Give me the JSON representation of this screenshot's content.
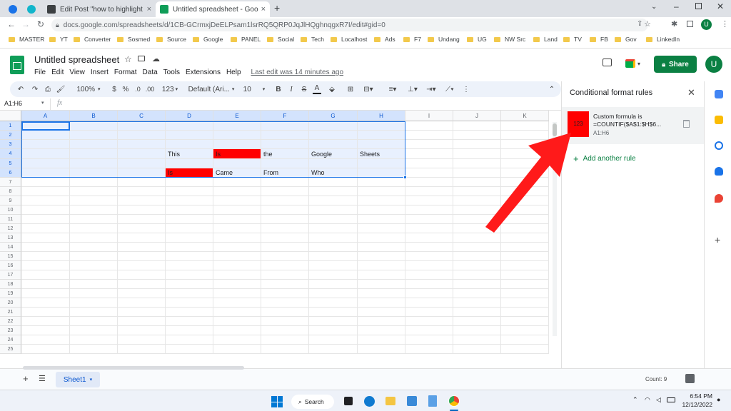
{
  "browser": {
    "tabs": [
      {
        "title": "",
        "color": "#1a73e8"
      },
      {
        "title": "",
        "color": "#12b5cb"
      },
      {
        "title": "Edit Post \"how to highlight dupli...",
        "color": "#3c4043"
      },
      {
        "title": "Untitled spreadsheet - Google Sh...",
        "color": "#0f9d58"
      }
    ],
    "new_tab": "+",
    "url": "docs.google.com/spreadsheets/d/1CB-GCrmxjDeELPsam1lsrRQ5QRP0JqJlHQghnqgxR7I/edit#gid=0",
    "profile": "U",
    "bookmarks": [
      "MASTER",
      "YT",
      "Converter",
      "Sosmed",
      "Source",
      "Google",
      "PANEL",
      "Social",
      "Tech",
      "Localhost",
      "Ads",
      "F7",
      "Undang",
      "UG",
      "NW Src",
      "Land",
      "TV",
      "FB",
      "Gov",
      "LinkedIn"
    ]
  },
  "sheets": {
    "title": "Untitled spreadsheet",
    "menus": [
      "File",
      "Edit",
      "View",
      "Insert",
      "Format",
      "Data",
      "Tools",
      "Extensions",
      "Help"
    ],
    "last_edit": "Last edit was 14 minutes ago",
    "share_label": "Share",
    "avatar": "U",
    "toolbar": {
      "zoom": "100%",
      "currency": "$",
      "percent": "%",
      "dec_less": ".0",
      "dec_more": ".00",
      "number_format": "123",
      "font": "Default (Ari...",
      "font_size": "10",
      "bold": "B",
      "italic": "I",
      "strike": "S",
      "text_color": "A"
    },
    "name_box": "A1:H6",
    "fx": "fx",
    "columns": [
      "A",
      "B",
      "C",
      "D",
      "E",
      "F",
      "G",
      "H",
      "I",
      "J",
      "K"
    ],
    "rows": [
      "1",
      "2",
      "3",
      "4",
      "5",
      "6",
      "7",
      "8",
      "9",
      "10",
      "11",
      "12",
      "13",
      "14",
      "15",
      "16",
      "17",
      "18",
      "19",
      "20",
      "21",
      "22",
      "23",
      "24",
      "25"
    ],
    "cells": {
      "D4": "This",
      "E4": "Is",
      "F4": "the",
      "G4": "Google",
      "H4": "Sheets",
      "D6": "Is",
      "E6": "Came",
      "F6": "From",
      "G6": "Who"
    },
    "highlight_color": "#ff0000",
    "selection_color": "#e8f0fe",
    "sheet_tab": "Sheet1",
    "count": "Count: 9"
  },
  "panel": {
    "title": "Conditional format rules",
    "rule": {
      "preview": "123",
      "line1": "Custom formula is",
      "line2": "=COUNTIF($A$1:$H$6...",
      "range": "A1:H6"
    },
    "add_rule": "Add another rule"
  },
  "taskbar": {
    "search": "Search",
    "time": "6:54 PM",
    "date": "12/12/2022"
  },
  "annotation": {
    "arrow_color": "#ff1a1a"
  }
}
